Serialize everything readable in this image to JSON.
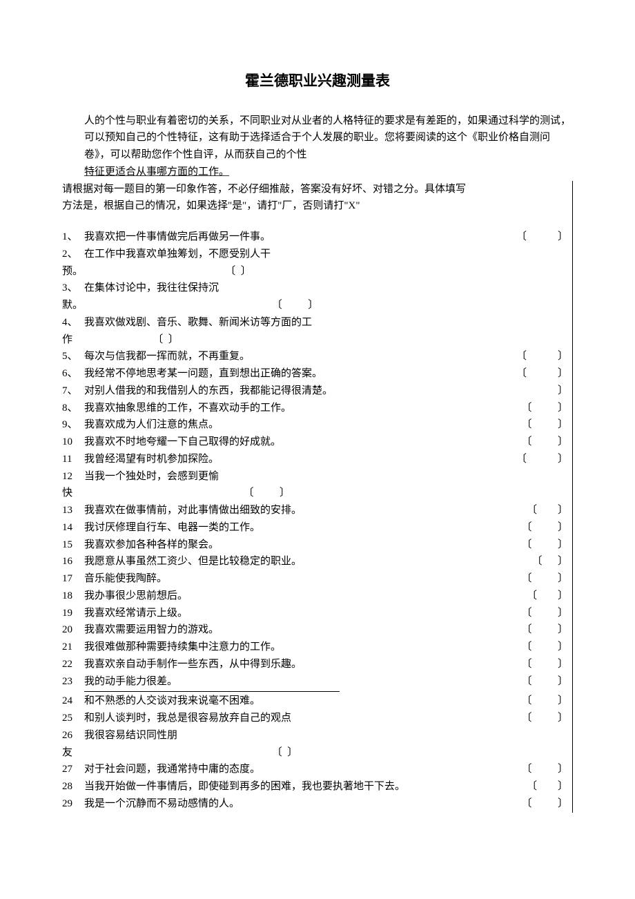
{
  "title": "霍兰德职业兴趣测量表",
  "intro": {
    "p1": "人的个性与职业有着密切的关系，不同职业对从业者的人格特征的要求是有差距的，如果通过科学的测试，可以预知自己的个性特征，这有助于选择适合于个人发展的职业。您将要阅读的这个《职业价格自测问卷》，可以帮助您作个性自评，从而获自己的个性",
    "underlined": "特征更适合从事哪方面的工作。",
    "p2": "请根据对每一题目的第一印象作答，不必仔细推敲，答案没有好坏、对错之分。具体填写"
  },
  "instruction": "方法是，根据自己的情况，如果选择\"是\"，请打\"厂，否则请打\"X\"",
  "questions": [
    {
      "num": "1、",
      "text": "我喜欢把一件事情做完后再做另一件事。",
      "lb": "〔",
      "rb": "〕",
      "bpad": "            "
    },
    {
      "num": "2、",
      "text": "在工作中我喜欢单独筹划，不愿受别人干",
      "wrap": "预。",
      "lb_wrap": "〔  〕",
      "wrap_pad": "                                                       "
    },
    {
      "num": "3、",
      "text": "在集体讨论中，我往往保持沉",
      "wrap": "默。",
      "lb_wrap": "〔          〕",
      "wrap_pad": "                                                                         "
    },
    {
      "num": "4、",
      "text": "我喜欢做戏剧、音乐、歌舞、新闻米访等方面的工",
      "wrap": "作",
      "lb_wrap": "〔  〕",
      "wrap_pad": "                               "
    },
    {
      "num": "5、",
      "text": "每次与信我都一挥而就，不再重复。",
      "lb": "〔",
      "rb": "〕",
      "bpad": "            "
    },
    {
      "num": "6、",
      "text": "我经常不停地思考某一问题，直到想出正确的答案。",
      "lb": "〔",
      "rb": "〕",
      "bpad": "            "
    },
    {
      "num": "7、",
      "text": "对别人借我的和我借别人的东西，我都能记得很清楚。",
      "lb": "",
      "rb": "〕",
      "bpad": ""
    },
    {
      "num": "8、",
      "text": "我喜欢抽象思维的工作，不喜欢动手的工作。",
      "lb": "〔",
      "rb": "〕",
      "bpad": "          "
    },
    {
      "num": "9、",
      "text": "我喜欢成为人们注意的焦点。",
      "lb": "〔",
      "rb": "〕",
      "bpad": "          "
    },
    {
      "num": "10",
      "text": "我喜欢不时地夸耀一下自己取得的好成就。",
      "lb": "〔",
      "rb": "〕",
      "bpad": "          "
    },
    {
      "num": "11",
      "text": "我曾经渴望有时机参加探险。",
      "lb": "〔",
      "rb": "〕",
      "bpad": "            "
    },
    {
      "num": "12",
      "text": "当我一个独处时，会感到更愉",
      "wrap": "快",
      "lb_wrap": "〔          〕",
      "wrap_pad": "                                                                  "
    },
    {
      "num": "13",
      "text": "我喜欢在做事情前，对此事情做出细致的安排。",
      "lb": "〔",
      "rb": "〕",
      "bpad": "        "
    },
    {
      "num": "14",
      "text": "我讨厌修理自行车、电器一类的工作。",
      "lb": "〔",
      "rb": "〕",
      "bpad": "          "
    },
    {
      "num": "15",
      "text": "我喜欢参加各种各样的聚会。",
      "lb": "〔",
      "rb": "〕",
      "bpad": "          "
    },
    {
      "num": "16",
      "text": "我愿意从事虽然工资少、但是比较稳定的职业。",
      "lb": "〔",
      "rb": "〕",
      "bpad": "      "
    },
    {
      "num": "17",
      "text": "音乐能使我陶醉。",
      "lb": "〔",
      "rb": "〕",
      "bpad": "          "
    },
    {
      "num": "18",
      "text": "我办事很少思前想后。",
      "lb": "〔",
      "rb": "〕",
      "bpad": "        "
    },
    {
      "num": "19",
      "text": "我喜欢经常请示上级。",
      "lb": "〔",
      "rb": "〕",
      "bpad": "          "
    },
    {
      "num": "20",
      "text": "我喜欢需要运用智力的游戏。",
      "lb": "〔",
      "rb": "〕",
      "bpad": "          "
    },
    {
      "num": "21",
      "text": "我很难做那种需要持续集中注意力的工作。",
      "lb": "〔",
      "rb": "〕",
      "bpad": "          "
    },
    {
      "num": "22",
      "text": "我喜欢亲自动手制作一些东西，从中得到乐趣。",
      "lb": "〔",
      "rb": "〕",
      "bpad": "          "
    },
    {
      "num": "23",
      "text": "我的动手能力很差。",
      "lb": "〔",
      "rb": "〕",
      "bpad": "          ",
      "hr_after": true
    },
    {
      "num": "24",
      "text": "和不熟悉的人交谈对我来说毫不困难。",
      "lb": "〔",
      "rb": "〕",
      "bpad": "          "
    },
    {
      "num": "25",
      "text": "和别人谈判时，我总是很容易放弃自己的观点",
      "lb": "〔",
      "rb": "〕",
      "bpad": "          "
    },
    {
      "num": "26",
      "text": "我很容易结识同性朋",
      "wrap": "友",
      "lb_wrap": "〔  〕",
      "wrap_pad": "                                                                             "
    },
    {
      "num": "27",
      "text": "对于社会问题，我通常持中庸的态度。",
      "lb": "〔",
      "rb": "〕",
      "bpad": "          "
    },
    {
      "num": "28",
      "text": "当我开始做一件事情后，即使碰到再多的困难，我也要执著地干下去。",
      "lb": "〔",
      "rb": "〕",
      "bpad": "        "
    },
    {
      "num": "29",
      "text": "我是一个沉静而不易动感情的人。",
      "lb": "〔",
      "rb": "〕",
      "bpad": "          "
    }
  ]
}
